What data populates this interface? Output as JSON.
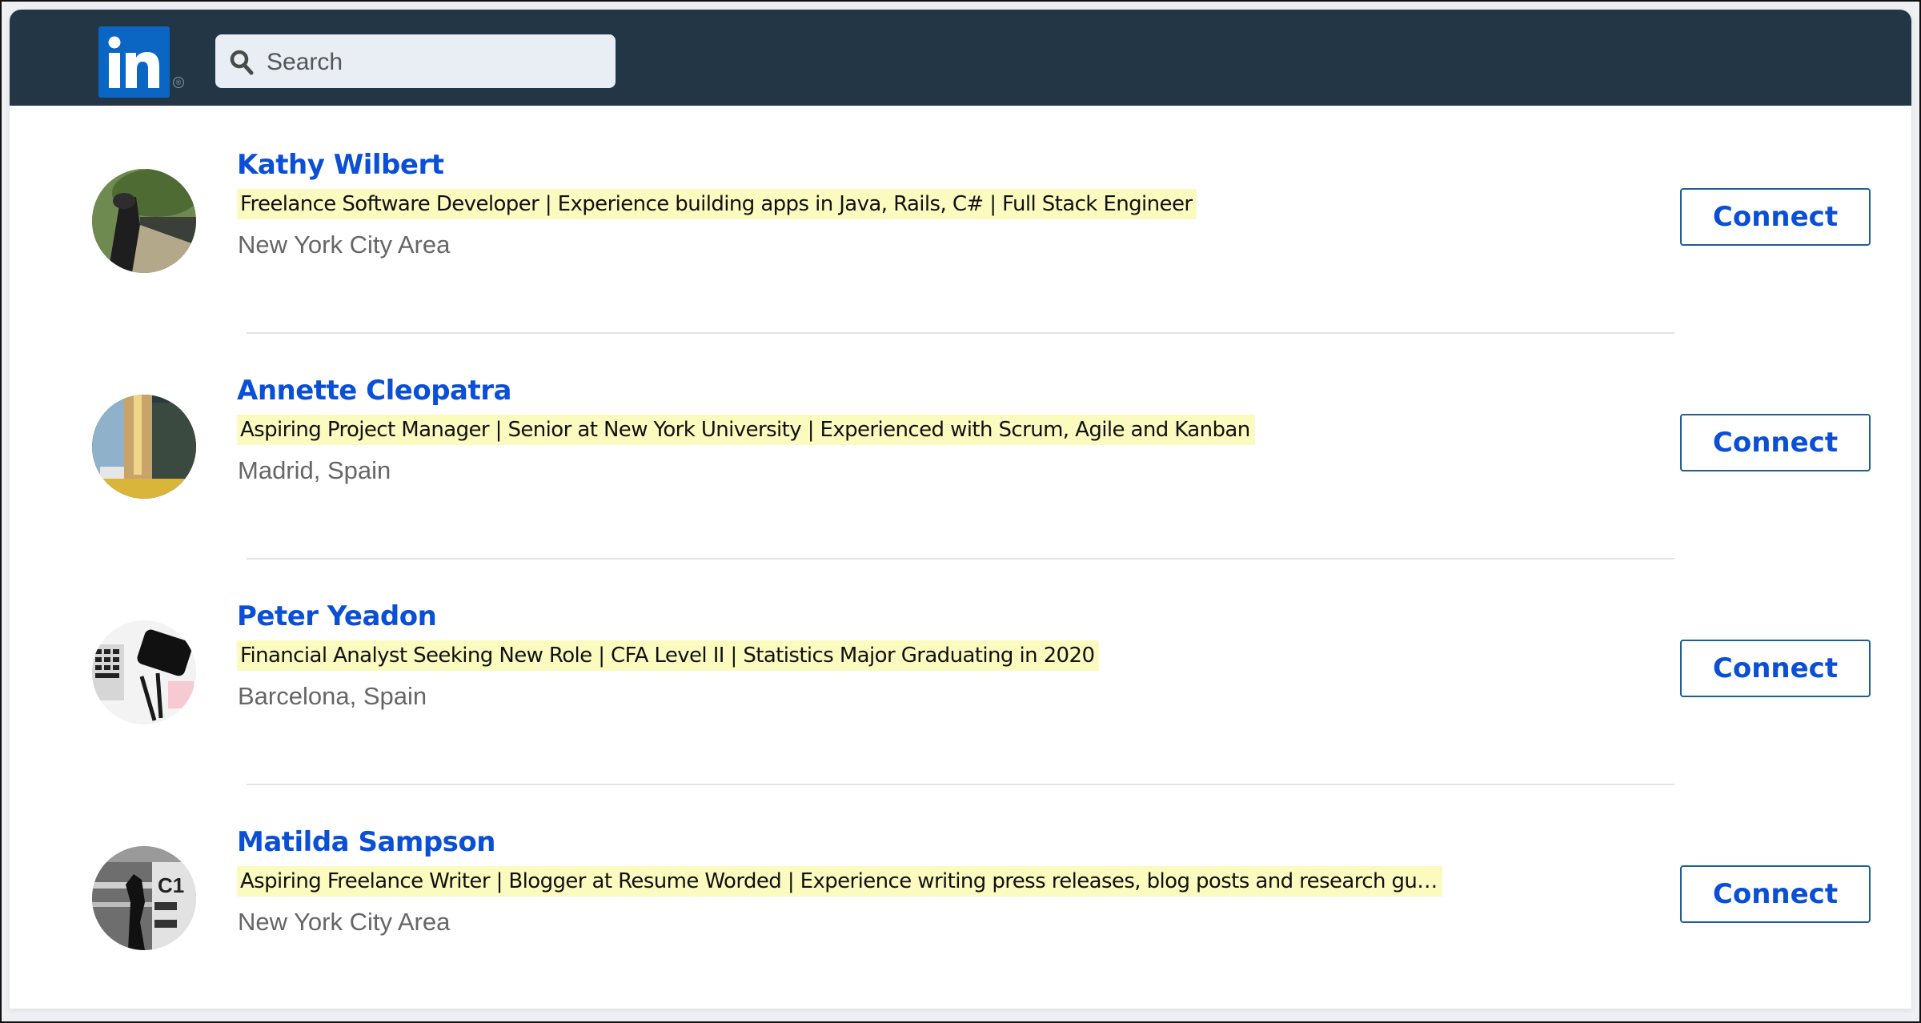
{
  "header": {
    "logo_label": "in",
    "logo_mark": "®",
    "search": {
      "placeholder": "Search",
      "value": "",
      "icon": "search-icon"
    }
  },
  "colors": {
    "header_bg": "#233645",
    "brand_blue": "#0a66c2",
    "link_blue": "#0a4fd6",
    "highlight": "#fbfbc0"
  },
  "results": [
    {
      "name": "Kathy Wilbert",
      "headline": "Freelance Software Developer | Experience building apps in Java, Rails, C# | Full Stack Engineer",
      "location": "New York City Area",
      "avatar": "photo-woman-with-binoculars",
      "action": "Connect"
    },
    {
      "name": "Annette Cleopatra",
      "headline": "Aspiring Project Manager | Senior at New York University | Experienced with Scrum, Agile and Kanban",
      "location": "Madrid, Spain",
      "avatar": "photo-city-skyline",
      "action": "Connect"
    },
    {
      "name": "Peter Yeadon",
      "headline": "Financial Analyst Seeking New Role | CFA Level II | Statistics Major Graduating in 2020",
      "location": "Barcelona, Spain",
      "avatar": "photo-desk-laptop-phone",
      "action": "Connect"
    },
    {
      "name": "Matilda Sampson",
      "headline": "Aspiring Freelance Writer | Blogger at Resume Worded | Experience writing press releases, blog posts and research gu…",
      "location": "New York City Area",
      "avatar": "photo-bw-silhouette",
      "action": "Connect"
    }
  ]
}
